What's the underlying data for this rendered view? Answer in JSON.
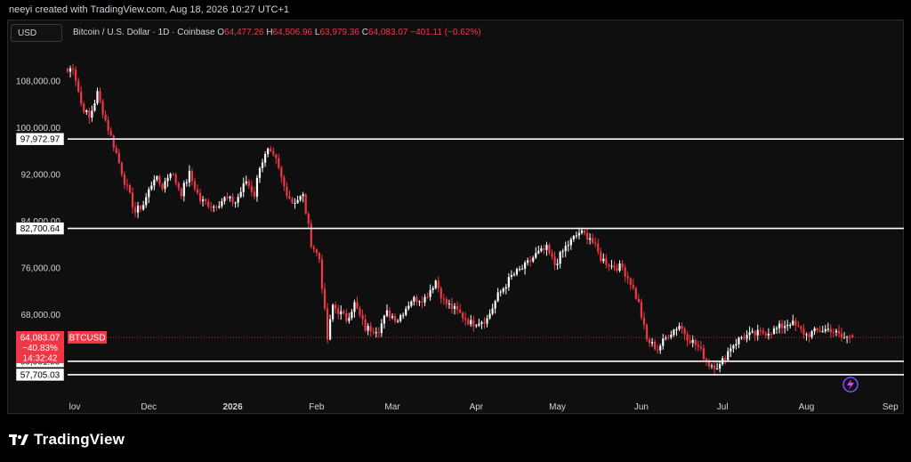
{
  "header": {
    "credit": "neeyi created with TradingView.com, Aug 18, 2026 10:27 UTC+1"
  },
  "toolbar": {
    "currency_button": "USD"
  },
  "legend": {
    "symbol": "Bitcoin / U.S. Dollar · 1D · Coinbase",
    "o_label": "O",
    "o_value": "64,477.26",
    "h_label": "H",
    "h_value": "64,506.96",
    "l_label": "L",
    "l_value": "63,979.36",
    "c_label": "C",
    "c_value": "64,083.07",
    "change": "−401.11 (−0.62%)"
  },
  "price_badge": {
    "price": "64,083.07",
    "change_pct": "−40.83%",
    "countdown": "14:32:42",
    "ticker": "BTCUSD"
  },
  "footer": {
    "brand": "TradingView"
  },
  "colors": {
    "up": "#ffffff",
    "down": "#f23645",
    "background": "#0f0f0f",
    "axis_text": "#d1d4dc",
    "level_line": "#ffffff"
  },
  "chart_data": {
    "type": "candlestick",
    "x_tick_labels": [
      "lov",
      "Dec",
      "2026",
      "Feb",
      "Mar",
      "Apr",
      "May",
      "Jun",
      "Jul",
      "Aug",
      "Sep"
    ],
    "y_tick_labels": [
      "108,000.00",
      "100,000.00",
      "92,000.00",
      "84,000.00",
      "76,000.00",
      "68,000.00"
    ],
    "y_ticks": [
      108000,
      100000,
      92000,
      84000,
      76000,
      68000
    ],
    "ylim": [
      54800,
      112300
    ],
    "xlim": [
      "2025-11-01",
      "2026-09-06"
    ],
    "levels": [
      {
        "value": 97972.97,
        "label": "97,972.97"
      },
      {
        "value": 82700.64,
        "label": "82,700.64"
      },
      {
        "value": 60001.0,
        "label": "60,001.00"
      },
      {
        "value": 57705.03,
        "label": "57,705.03"
      }
    ],
    "last_price": 64083.07,
    "anchors": [
      [
        "2025-11-01",
        109500
      ],
      [
        "2025-11-03",
        110400
      ],
      [
        "2025-11-06",
        104000
      ],
      [
        "2025-11-09",
        101500
      ],
      [
        "2025-11-12",
        105800
      ],
      [
        "2025-11-15",
        101200
      ],
      [
        "2025-11-19",
        95500
      ],
      [
        "2025-11-22",
        90800
      ],
      [
        "2025-11-26",
        85500
      ],
      [
        "2025-11-29",
        86800
      ],
      [
        "2025-12-03",
        91500
      ],
      [
        "2025-12-06",
        89800
      ],
      [
        "2025-12-09",
        92500
      ],
      [
        "2025-12-13",
        88800
      ],
      [
        "2025-12-16",
        92000
      ],
      [
        "2025-12-20",
        87500
      ],
      [
        "2025-12-25",
        86500
      ],
      [
        "2025-12-29",
        87800
      ],
      [
        "2026-01-02",
        87200
      ],
      [
        "2026-01-06",
        90800
      ],
      [
        "2026-01-09",
        88500
      ],
      [
        "2026-01-11",
        93500
      ],
      [
        "2026-01-14",
        95800
      ],
      [
        "2026-01-17",
        94200
      ],
      [
        "2026-01-20",
        89800
      ],
      [
        "2026-01-23",
        87200
      ],
      [
        "2026-01-27",
        88200
      ],
      [
        "2026-01-30",
        80200
      ],
      [
        "2026-02-02",
        77500
      ],
      [
        "2026-02-05",
        63800
      ],
      [
        "2026-02-07",
        69500
      ],
      [
        "2026-02-12",
        67200
      ],
      [
        "2026-02-15",
        69800
      ],
      [
        "2026-02-19",
        65600
      ],
      [
        "2026-02-24",
        65500
      ],
      [
        "2026-02-27",
        68200
      ],
      [
        "2026-03-03",
        67200
      ],
      [
        "2026-03-08",
        70500
      ],
      [
        "2026-03-13",
        70800
      ],
      [
        "2026-03-17",
        73800
      ],
      [
        "2026-03-20",
        70200
      ],
      [
        "2026-03-25",
        68500
      ],
      [
        "2026-03-30",
        66500
      ],
      [
        "2026-04-05",
        67200
      ],
      [
        "2026-04-09",
        71200
      ],
      [
        "2026-04-14",
        74500
      ],
      [
        "2026-04-19",
        76200
      ],
      [
        "2026-04-23",
        78200
      ],
      [
        "2026-04-27",
        79200
      ],
      [
        "2026-04-30",
        76500
      ],
      [
        "2026-05-04",
        79500
      ],
      [
        "2026-05-09",
        82000
      ],
      [
        "2026-05-13",
        81200
      ],
      [
        "2026-05-17",
        77600
      ],
      [
        "2026-05-21",
        76300
      ],
      [
        "2026-05-25",
        76000
      ],
      [
        "2026-05-28",
        73500
      ],
      [
        "2026-05-31",
        69800
      ],
      [
        "2026-06-03",
        63600
      ],
      [
        "2026-06-07",
        62100
      ],
      [
        "2026-06-11",
        64600
      ],
      [
        "2026-06-15",
        66200
      ],
      [
        "2026-06-18",
        64200
      ],
      [
        "2026-06-22",
        62400
      ],
      [
        "2026-06-26",
        59500
      ],
      [
        "2026-06-30",
        59200
      ],
      [
        "2026-07-04",
        62500
      ],
      [
        "2026-07-08",
        64100
      ],
      [
        "2026-07-14",
        64700
      ],
      [
        "2026-07-20",
        65300
      ],
      [
        "2026-07-26",
        66700
      ],
      [
        "2026-08-01",
        64500
      ],
      [
        "2026-08-06",
        65300
      ],
      [
        "2026-08-10",
        65500
      ],
      [
        "2026-08-14",
        64000
      ],
      [
        "2026-08-18",
        64083
      ]
    ]
  }
}
